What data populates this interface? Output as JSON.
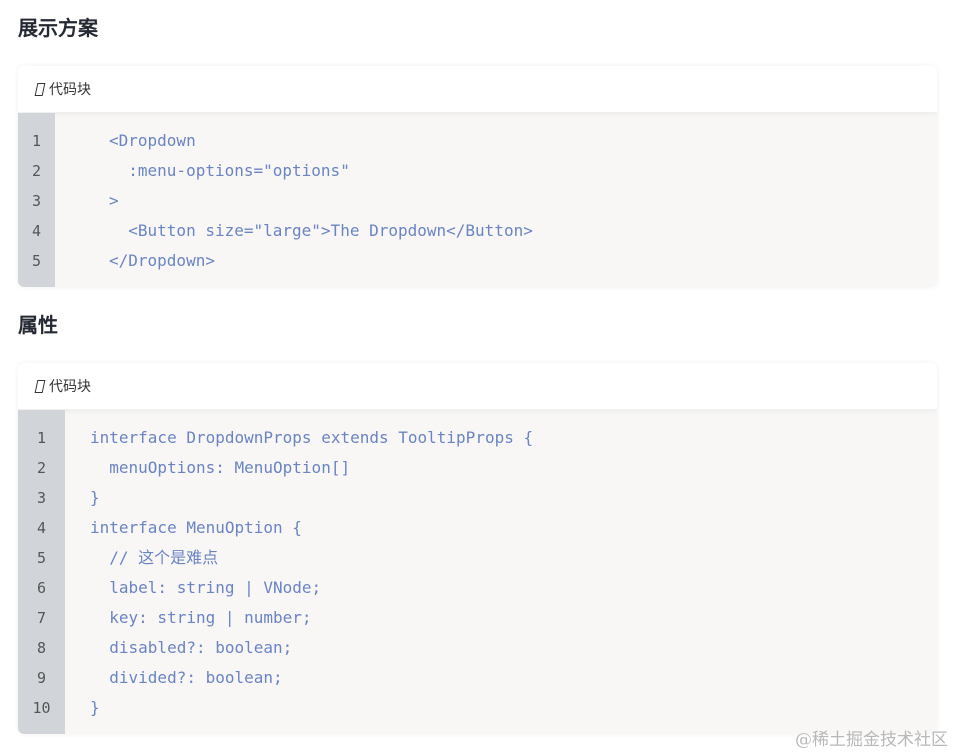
{
  "sections": [
    {
      "title": "展示方案",
      "block_label": "代码块",
      "lines": [
        "<Dropdown",
        "  :menu-options=\"options\"",
        ">",
        "  <Button size=\"large\">The Dropdown</Button>",
        "</Dropdown>"
      ],
      "line_numbers": [
        "1",
        "2",
        "3",
        "4",
        "5"
      ]
    },
    {
      "title": "属性",
      "block_label": "代码块",
      "lines": [
        "interface DropdownProps extends TooltipProps {",
        "  menuOptions: MenuOption[]",
        "}",
        "interface MenuOption {",
        "  // 这个是难点",
        "  label: string | VNode;",
        "  key: string | number;",
        "  disabled?: boolean;",
        "  divided?: boolean;",
        "}"
      ],
      "line_numbers": [
        "1",
        "2",
        "3",
        "4",
        "5",
        "6",
        "7",
        "8",
        "9",
        "10"
      ]
    }
  ],
  "watermark": "@稀土掘金技术社区",
  "colors": {
    "code_text": "#6a84c4",
    "gutter_bg": "#d1d5da",
    "code_bg": "#f8f7f5"
  },
  "icons": {
    "block_label_icon": "document-icon"
  }
}
